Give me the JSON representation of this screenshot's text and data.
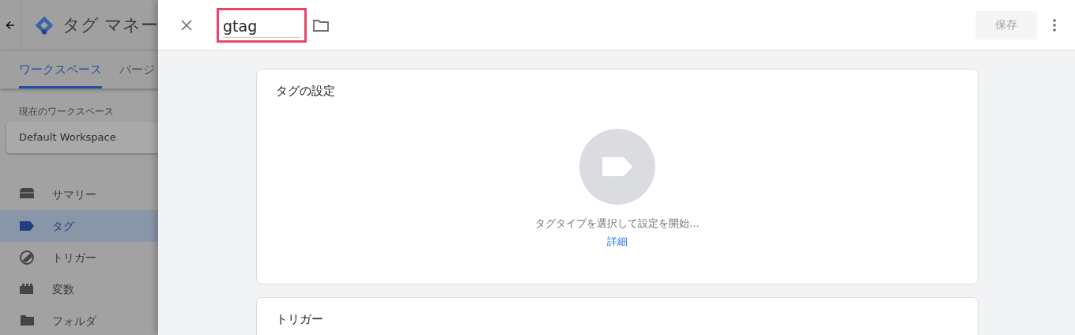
{
  "background_app": {
    "title": "タグ マネー",
    "tabs": [
      {
        "label": "ワークスペース",
        "selected": true
      },
      {
        "label": "バージ",
        "selected": false
      }
    ],
    "workspace_label": "現在のワークスペース",
    "workspace_name": "Default Workspace",
    "nav": [
      {
        "label": "サマリー",
        "kind": "summary",
        "selected": false
      },
      {
        "label": "タグ",
        "kind": "tag",
        "selected": true
      },
      {
        "label": "トリガー",
        "kind": "trigger",
        "selected": false
      },
      {
        "label": "変数",
        "kind": "variable",
        "selected": false
      },
      {
        "label": "フォルダ",
        "kind": "folder",
        "selected": false
      }
    ]
  },
  "editor": {
    "name_value": "gtag",
    "save_button": {
      "label": "保存",
      "disabled": true
    },
    "sections": [
      {
        "title": "タグの設定",
        "kind": "tag_config",
        "hint": "タグタイプを選択して設定を開始...",
        "link": "詳細"
      },
      {
        "title": "トリガー",
        "kind": "trigger"
      }
    ]
  }
}
